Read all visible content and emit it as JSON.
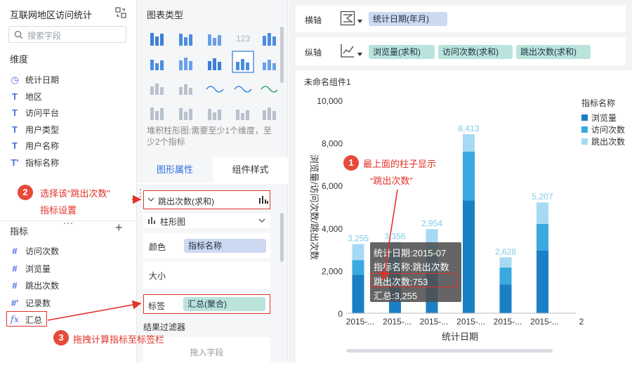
{
  "left": {
    "title": "互联网地区访问统计",
    "search_placeholder": "搜索字段",
    "dim_header": "维度",
    "dims": [
      {
        "icon": "clock-icon",
        "glyph": "◷",
        "label": "统计日期"
      },
      {
        "icon": "text-field-icon",
        "glyph": "T",
        "label": "地区"
      },
      {
        "icon": "text-field-icon",
        "glyph": "T",
        "label": "访问平台"
      },
      {
        "icon": "text-field-icon",
        "glyph": "T",
        "label": "用户类型"
      },
      {
        "icon": "text-field-icon",
        "glyph": "T",
        "label": "用户名称"
      },
      {
        "icon": "text-field-icon",
        "glyph": "T'",
        "label": "指标名称"
      }
    ],
    "metric_header": "指标",
    "add_glyph": "+",
    "metrics": [
      {
        "icon": "number-field-icon",
        "glyph": "#",
        "label": "访问次数"
      },
      {
        "icon": "number-field-icon",
        "glyph": "#",
        "label": "浏览量"
      },
      {
        "icon": "number-field-icon",
        "glyph": "#",
        "label": "跳出次数"
      },
      {
        "icon": "number-field-icon",
        "glyph": "#'",
        "label": "记录数"
      },
      {
        "icon": "formula-icon",
        "glyph": "fx",
        "label": "汇总"
      }
    ]
  },
  "mid": {
    "chart_type_header": "图表类型",
    "hint": "堆积柱形图:需要至少1个维度，至少2个指标",
    "tab_props": "图形属性",
    "tab_style": "组件样式",
    "field_sel": "跳出次数(求和)",
    "chart_kind": "柱形图",
    "color_label": "颜色",
    "color_value": "指标名称",
    "size_label": "大小",
    "tag_label": "标签",
    "tag_value": "汇总(聚合)",
    "filter_header": "结果过滤器",
    "drop_hint": "拖入字段"
  },
  "axes": {
    "x_label": "横轴",
    "x_field": "统计日期(年月)",
    "y_label": "纵轴",
    "y_fields": [
      "浏览量(求和)",
      "访问次数(求和)",
      "跳出次数(求和)"
    ]
  },
  "widget_title": "未命名组件1",
  "legend": {
    "title": "指标名称",
    "items": [
      {
        "name": "浏览量",
        "color": "#1a7fc4"
      },
      {
        "name": "访问次数",
        "color": "#39a9e0"
      },
      {
        "name": "跳出次数",
        "color": "#a6daf4"
      }
    ]
  },
  "chart_data": {
    "type": "bar",
    "stacked": true,
    "ylabel": "浏览量/访问次数/跳出次数",
    "xlabel": "统计日期",
    "ylim": [
      0,
      10000
    ],
    "yticks": [
      "0",
      "2,000",
      "4,000",
      "6,000",
      "8,000",
      "10,000"
    ],
    "categories": [
      "2015-...",
      "2015-...",
      "2015-...",
      "2015-...",
      "2015-...",
      "2015-...",
      "2"
    ],
    "series": [
      {
        "name": "浏览量",
        "values": [
          1800,
          2100,
          1850,
          5300,
          1350,
          2950
        ]
      },
      {
        "name": "访问次数",
        "values": [
          700,
          800,
          850,
          2300,
          800,
          1250
        ]
      },
      {
        "name": "跳出次数",
        "values": [
          755,
          456,
          1254,
          813,
          478,
          1007
        ]
      }
    ],
    "totals": [
      "3,255",
      "3,356",
      "2,954",
      "8,413",
      "2,628",
      "5,207"
    ]
  },
  "tooltip": {
    "line1": "统计日期:2015-07",
    "line2": "指标名称:跳出次数",
    "line3": "跳出次数:753",
    "line4": "汇总:3,255"
  },
  "annotations": {
    "n1": "1",
    "t1a": "最上面的柱子显示",
    "t1b": "“跳出次数”",
    "n2": "2",
    "t2a": "选择该“跳出次数”",
    "t2b": "指标设置",
    "n3": "3",
    "t3": "拖拽计算指标至标签栏"
  }
}
